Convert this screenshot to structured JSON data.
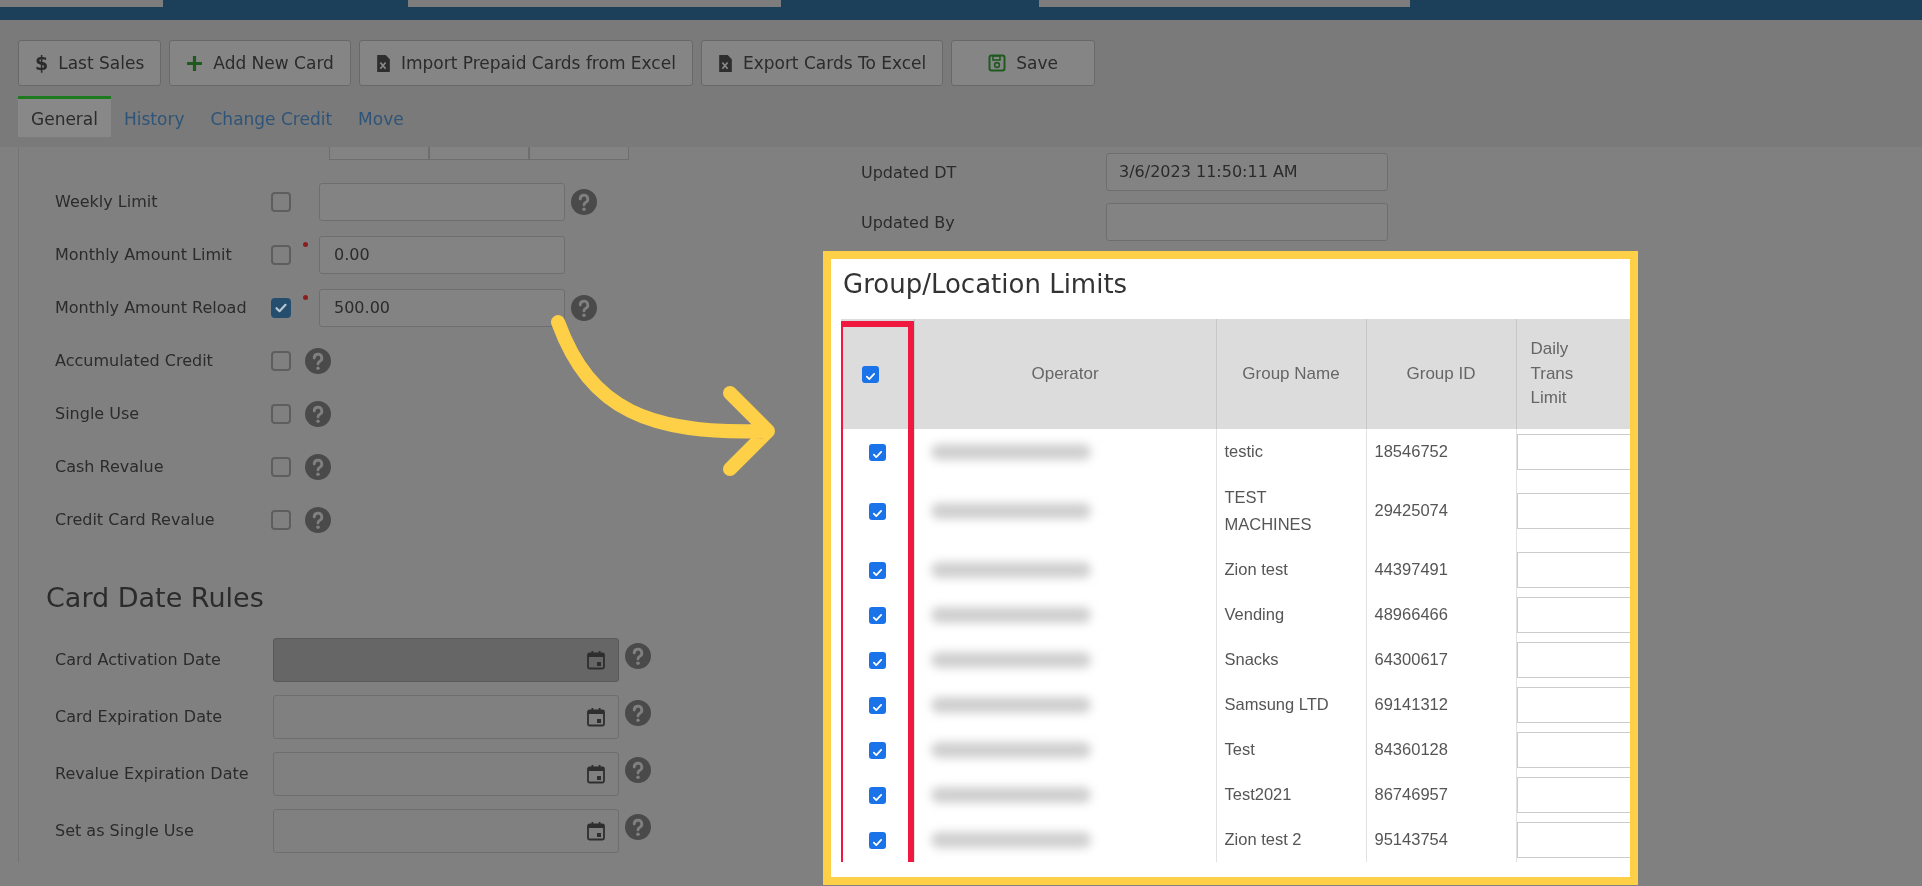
{
  "toolbar": [
    {
      "label": "Last Sales",
      "symbol": "$"
    },
    {
      "label": "Add New Card"
    },
    {
      "label": "Import Prepaid Cards from Excel"
    },
    {
      "label": "Export Cards To Excel"
    },
    {
      "label": "Save"
    }
  ],
  "tabs": [
    {
      "label": "General",
      "selected": true
    },
    {
      "label": "History",
      "selected": false
    },
    {
      "label": "Change Credit",
      "selected": false
    },
    {
      "label": "Move",
      "selected": false
    }
  ],
  "limits": [
    {
      "label": "Weekly Limit",
      "kind": "input",
      "checked": false,
      "required": false,
      "help": true
    },
    {
      "label": "Monthly Amount Limit",
      "kind": "input",
      "checked": false,
      "required": true,
      "value": "0.00",
      "help": false
    },
    {
      "label": "Monthly Amount Reload",
      "kind": "input",
      "checked": true,
      "required": true,
      "value": "500.00",
      "help": true
    },
    {
      "label": "Accumulated Credit",
      "kind": "checkbox",
      "checked": false,
      "help": true
    },
    {
      "label": "Single Use",
      "kind": "checkbox",
      "checked": false,
      "help": true
    },
    {
      "label": "Cash Revalue",
      "kind": "checkbox",
      "checked": false,
      "help": true
    },
    {
      "label": "Credit Card Revalue",
      "kind": "checkbox",
      "checked": false,
      "help": true
    }
  ],
  "card_date_rules": {
    "title": "Card Date Rules",
    "fields": [
      {
        "label": "Card Activation Date",
        "disabled": true
      },
      {
        "label": "Card Expiration Date",
        "disabled": false
      },
      {
        "label": "Revalue Expiration Date",
        "disabled": false
      },
      {
        "label": "Set as Single Use",
        "disabled": false
      }
    ]
  },
  "audit": [
    {
      "label": "Updated DT",
      "value": "3/6/2023 11:50:11 AM"
    },
    {
      "label": "Updated By"
    }
  ],
  "group_limits": {
    "title": "Group/Location Limits",
    "header_checked": true,
    "columns": [
      "Operator",
      "Group Name",
      "Group ID",
      "Daily Trans Limit"
    ],
    "rows": [
      {
        "checked": true,
        "group_name": "testic",
        "group_id": "18546752"
      },
      {
        "checked": true,
        "group_name": "TEST MACHINES",
        "group_id": "29425074"
      },
      {
        "checked": true,
        "group_name": "Zion test",
        "group_id": "44397491"
      },
      {
        "checked": true,
        "group_name": "Vending",
        "group_id": "48966466"
      },
      {
        "checked": true,
        "group_name": "Snacks",
        "group_id": "64300617"
      },
      {
        "checked": true,
        "group_name": "Samsung LTD",
        "group_id": "69141312"
      },
      {
        "checked": true,
        "group_name": "Test",
        "group_id": "84360128"
      },
      {
        "checked": true,
        "group_name": "Test2021",
        "group_id": "86746957"
      },
      {
        "checked": true,
        "group_name": "Zion test 2",
        "group_id": "95143754"
      }
    ]
  }
}
